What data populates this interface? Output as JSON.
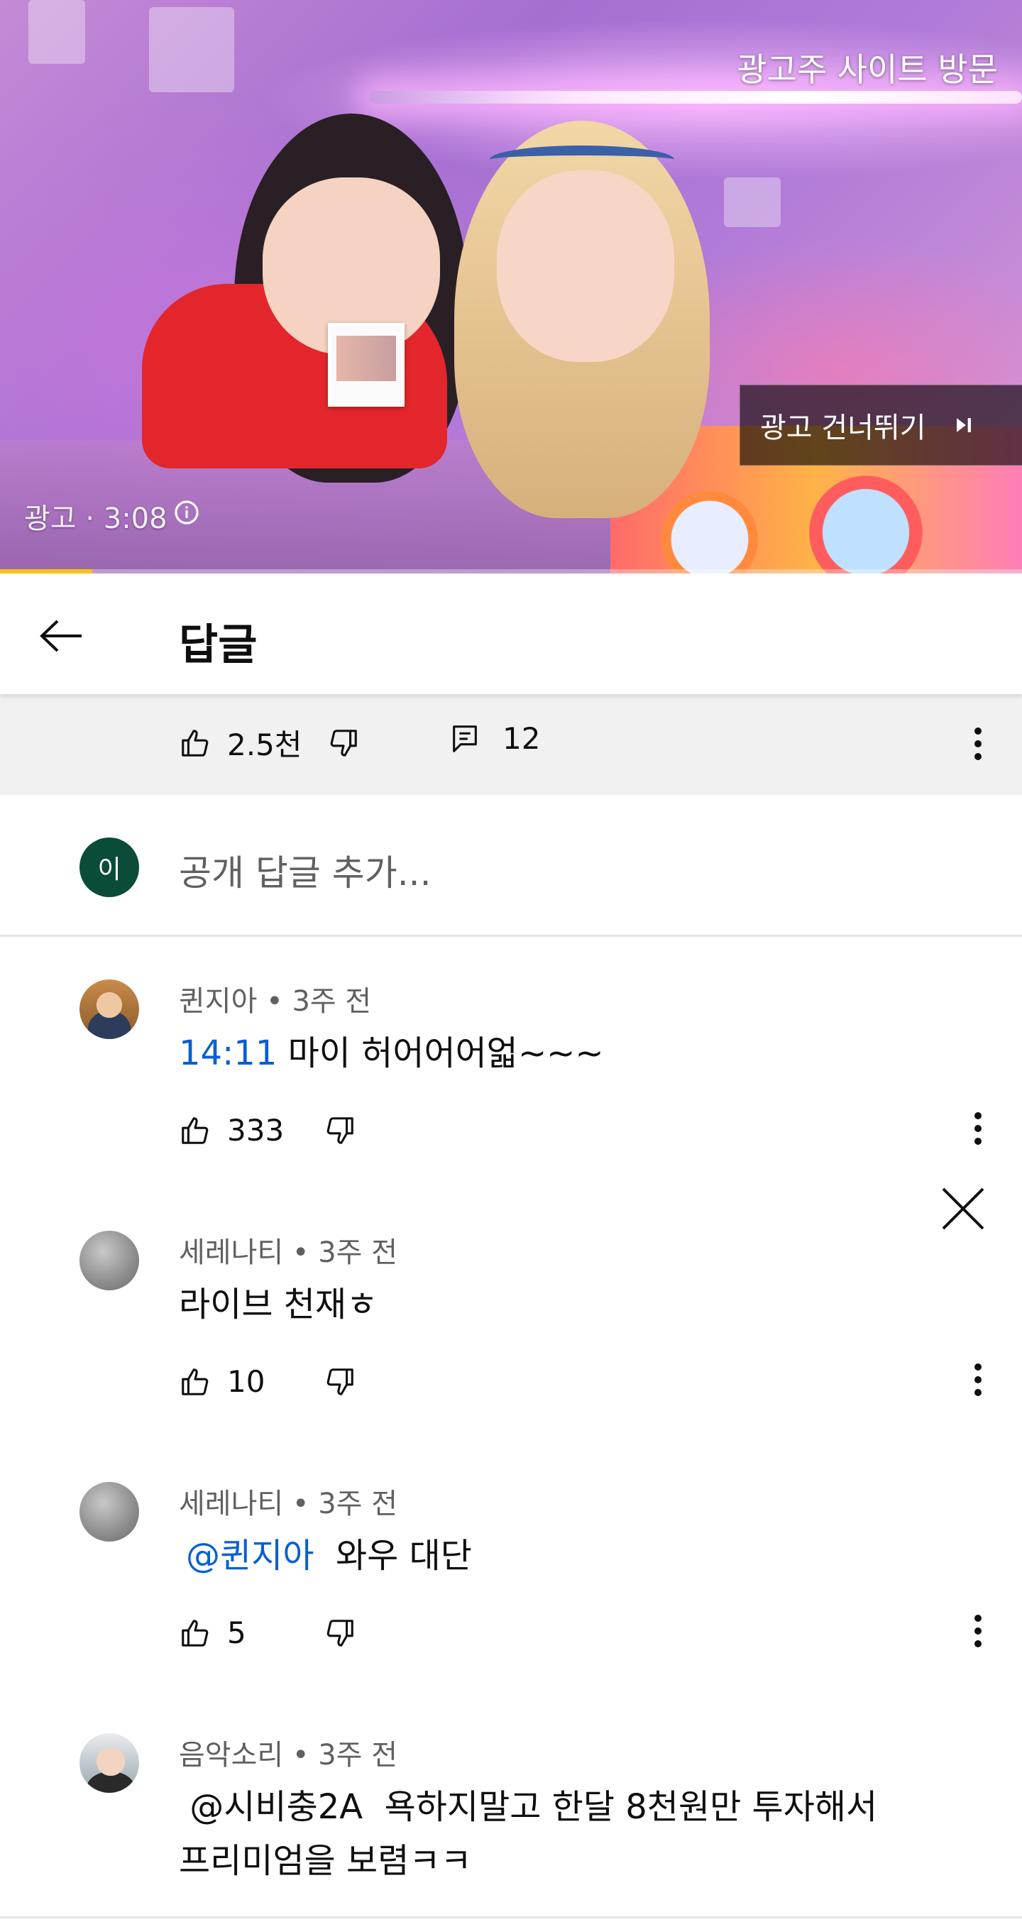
{
  "ad": {
    "visit_site_label": "광고주 사이트 방문",
    "skip_label": "광고 건너뛰기",
    "meta_label": "광고 · 3:08",
    "progress_fraction": 0.09
  },
  "header": {
    "title": "답글"
  },
  "parent_comment": {
    "like_count": "2.5천",
    "reply_count": "12"
  },
  "add_reply": {
    "avatar_initial": "이",
    "placeholder": "공개 답글 추가..."
  },
  "replies": [
    {
      "author": "퀸지아",
      "time": "3주 전",
      "timestamp": "14:11",
      "text": " 마이 허어어어얿~~~",
      "likes": "333"
    },
    {
      "author": "세레나티",
      "time": "3주 전",
      "text": "라이브 천재ㅎ",
      "likes": "10"
    },
    {
      "author": "세레나티",
      "time": "3주 전",
      "mention": "@퀸지아",
      "text": "  와우 대단",
      "likes": "5"
    },
    {
      "author": "음악소리",
      "time": "3주 전",
      "line1": " @시비충2A  욕하지말고 한달 8천원만 투자해서",
      "line2": "프리미엄을 보렴ㅋㅋ"
    }
  ],
  "meta_separator": " • ",
  "colors": {
    "link_blue": "#065fd4",
    "ad_progress": "#f6c21b",
    "own_avatar": "#0b4b3a"
  },
  "icons": [
    "arrow-left-icon",
    "close-icon",
    "thumb-up-icon",
    "thumb-down-icon",
    "comment-icon",
    "more-vert-icon",
    "info-icon",
    "skip-next-icon"
  ]
}
